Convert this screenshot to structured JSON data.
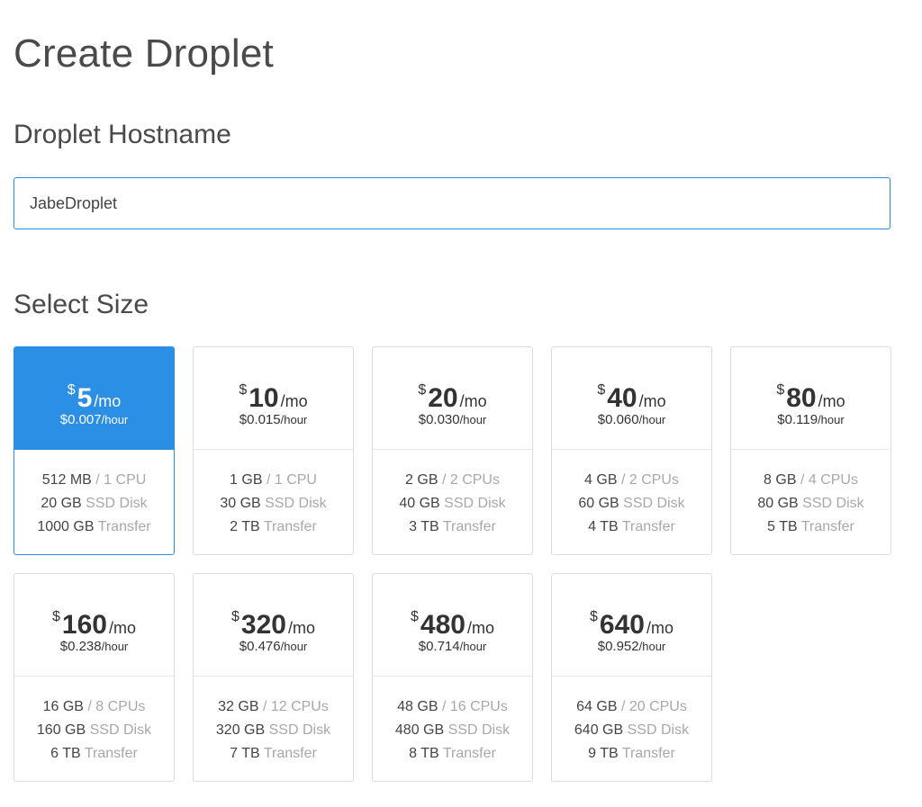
{
  "page": {
    "title": "Create Droplet"
  },
  "hostname": {
    "section_title": "Droplet Hostname",
    "value": "JabeDroplet"
  },
  "size": {
    "section_title": "Select Size",
    "per_month_suffix": "/mo",
    "per_hour_suffix": "/hour",
    "currency_symbol": "$",
    "selected_index": 0,
    "accent_color": "#2b8fe6",
    "plans": [
      {
        "price": "5",
        "hourly": "$0.007",
        "memory": "512 MB",
        "cpu": "/ 1 CPU",
        "disk": "20 GB",
        "disk_label": "SSD Disk",
        "transfer": "1000 GB",
        "transfer_label": "Transfer"
      },
      {
        "price": "10",
        "hourly": "$0.015",
        "memory": "1 GB",
        "cpu": "/ 1 CPU",
        "disk": "30 GB",
        "disk_label": "SSD Disk",
        "transfer": "2 TB",
        "transfer_label": "Transfer"
      },
      {
        "price": "20",
        "hourly": "$0.030",
        "memory": "2 GB",
        "cpu": "/ 2 CPUs",
        "disk": "40 GB",
        "disk_label": "SSD Disk",
        "transfer": "3 TB",
        "transfer_label": "Transfer"
      },
      {
        "price": "40",
        "hourly": "$0.060",
        "memory": "4 GB",
        "cpu": "/ 2 CPUs",
        "disk": "60 GB",
        "disk_label": "SSD Disk",
        "transfer": "4 TB",
        "transfer_label": "Transfer"
      },
      {
        "price": "80",
        "hourly": "$0.119",
        "memory": "8 GB",
        "cpu": "/ 4 CPUs",
        "disk": "80 GB",
        "disk_label": "SSD Disk",
        "transfer": "5 TB",
        "transfer_label": "Transfer"
      },
      {
        "price": "160",
        "hourly": "$0.238",
        "memory": "16 GB",
        "cpu": "/ 8 CPUs",
        "disk": "160 GB",
        "disk_label": "SSD Disk",
        "transfer": "6 TB",
        "transfer_label": "Transfer"
      },
      {
        "price": "320",
        "hourly": "$0.476",
        "memory": "32 GB",
        "cpu": "/ 12 CPUs",
        "disk": "320 GB",
        "disk_label": "SSD Disk",
        "transfer": "7 TB",
        "transfer_label": "Transfer"
      },
      {
        "price": "480",
        "hourly": "$0.714",
        "memory": "48 GB",
        "cpu": "/ 16 CPUs",
        "disk": "480 GB",
        "disk_label": "SSD Disk",
        "transfer": "8 TB",
        "transfer_label": "Transfer"
      },
      {
        "price": "640",
        "hourly": "$0.952",
        "memory": "64 GB",
        "cpu": "/ 20 CPUs",
        "disk": "640 GB",
        "disk_label": "SSD Disk",
        "transfer": "9 TB",
        "transfer_label": "Transfer"
      }
    ]
  }
}
